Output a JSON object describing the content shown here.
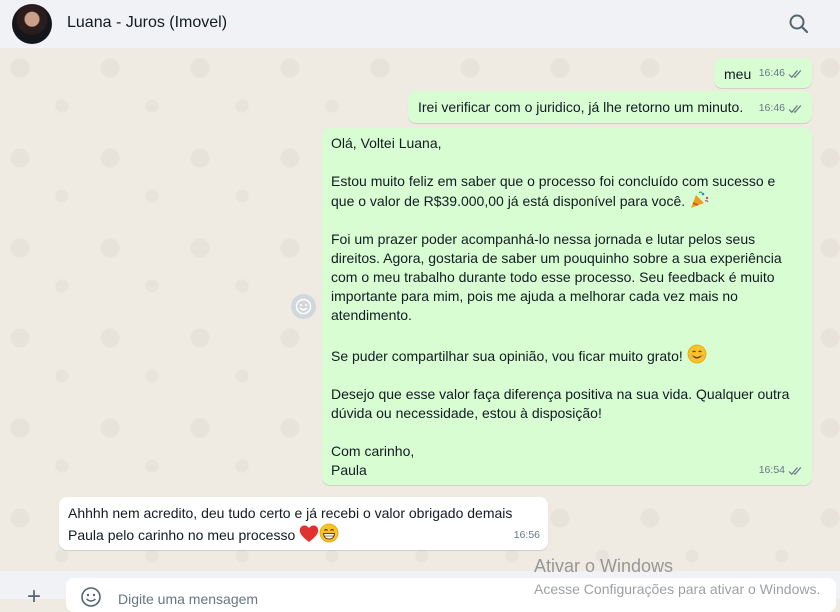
{
  "header": {
    "contact_name": "Luana - Juros (Imovel)",
    "avatar_icon": "profile-photo",
    "search_icon": "search-icon"
  },
  "messages": [
    {
      "direction": "out",
      "text": "meu",
      "time": "16:46",
      "status": "read"
    },
    {
      "direction": "out",
      "text": "Irei verificar com o juridico, já lhe retorno um minuto.",
      "time": "16:46",
      "status": "read"
    },
    {
      "direction": "out",
      "paragraphs": [
        "Olá, Voltei Luana,",
        "Estou muito feliz em saber que o processo foi concluído com sucesso e que o valor de R$39.000,00 já está disponível para você.",
        "Foi um prazer poder acompanhá-lo nessa jornada e lutar pelos seus direitos. Agora, gostaria de saber um pouquinho sobre a sua experiência com o meu trabalho durante todo esse processo. Seu feedback é muito importante para mim, pois me ajuda a melhorar cada vez mais no atendimento.",
        "Se puder compartilhar sua opinião, vou ficar muito grato!",
        "Desejo que esse valor faça diferença positiva na sua vida. Qualquer outra dúvida ou necessidade, estou à disposição!",
        "Com carinho,\nPaula"
      ],
      "emojis": [
        "party-popper",
        "smiling-face"
      ],
      "time": "16:54",
      "status": "read"
    },
    {
      "direction": "in",
      "text": "Ahhhh nem acredito, deu tudo certo e já recebi o valor obrigado demais Paula pelo carinho no meu processo",
      "emojis": [
        "red-heart",
        "grinning-face"
      ],
      "time": "16:56"
    }
  ],
  "composer": {
    "placeholder": "Digite uma mensagem",
    "attach_icon": "plus-icon",
    "emoji_icon": "emoji-icon"
  },
  "watermark": {
    "title": "Ativar o Windows",
    "subtitle": "Acesse Configurações para ativar o Windows."
  },
  "colors": {
    "outgoing_bubble": "#d9fdd3",
    "incoming_bubble": "#ffffff",
    "chat_background": "#efeae2",
    "header_background": "#f0f2f5",
    "read_ticks": "#667781"
  }
}
